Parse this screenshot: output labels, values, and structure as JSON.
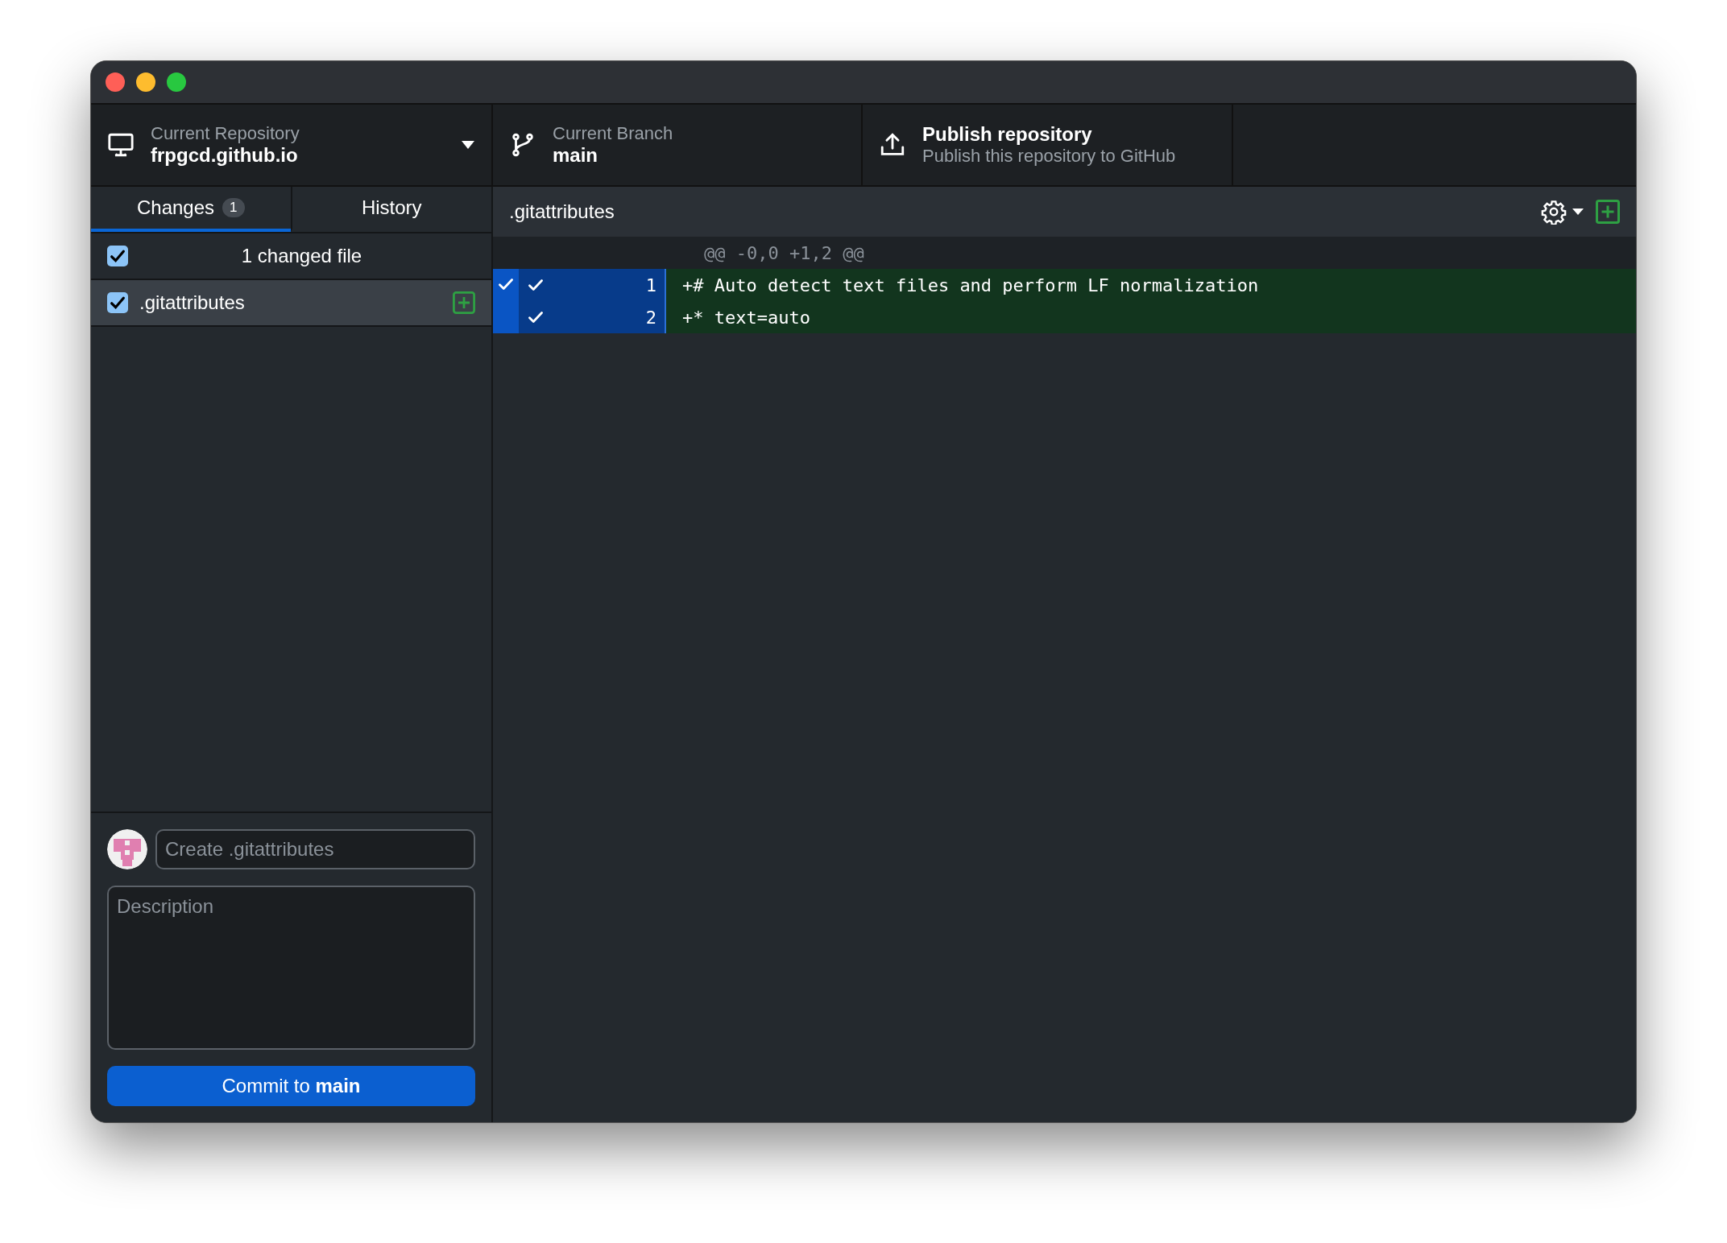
{
  "toolbar": {
    "repository": {
      "label": "Current Repository",
      "value": "frpgcd.github.io"
    },
    "branch": {
      "label": "Current Branch",
      "value": "main"
    },
    "publish": {
      "title": "Publish repository",
      "subtitle": "Publish this repository to GitHub"
    }
  },
  "tabs": [
    {
      "label": "Changes",
      "count": "1",
      "selected": true
    },
    {
      "label": "History",
      "selected": false
    }
  ],
  "changes": {
    "summary": "1 changed file",
    "checked": true,
    "files": [
      {
        "name": ".gitattributes",
        "checked": true,
        "selected": true,
        "kind": "added"
      }
    ]
  },
  "commit": {
    "summary": {
      "placeholder": "Create .gitattributes"
    },
    "description": {
      "placeholder": "Description"
    },
    "button": "Commit to **main**"
  },
  "diff": {
    "file": ".gitattributes",
    "hunk_header": "@@ -0,0 +1,2 @@",
    "hunk_selected": true,
    "lines": [
      {
        "number": "1",
        "marker": "+",
        "text": "# Auto detect text files and perform LF normalization",
        "selected": true
      },
      {
        "number": "2",
        "marker": "+",
        "text": "* text=auto",
        "selected": true
      }
    ]
  }
}
